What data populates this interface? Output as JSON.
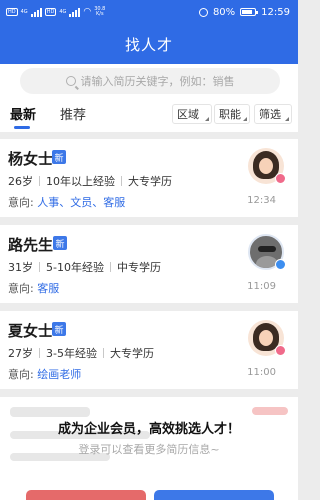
{
  "status_bar": {
    "left_badge_1": "HD",
    "left_badge_2": "HD",
    "network_1": "4G",
    "network_2": "4G",
    "speed_value": "30.8",
    "speed_unit": "K/s",
    "battery": "80%",
    "time": "12:59"
  },
  "header": {
    "title": "找人才"
  },
  "search": {
    "placeholder": "请输入简历关键字，例如：销售"
  },
  "tabs": [
    {
      "label": "最新",
      "active": true
    },
    {
      "label": "推荐",
      "active": false
    }
  ],
  "filters": [
    {
      "label": "区域"
    },
    {
      "label": "职能"
    },
    {
      "label": "筛选"
    }
  ],
  "candidates": [
    {
      "name": "杨女士",
      "badge": "新",
      "age": "26岁",
      "experience": "10年以上经验",
      "education": "大专学历",
      "intent_label": "意向:",
      "intent_jobs": "人事、文员、客服",
      "time": "12:34",
      "gender": "female",
      "avatar_icon": "female-avatar-icon"
    },
    {
      "name": "路先生",
      "badge": "新",
      "age": "31岁",
      "experience": "5-10年经验",
      "education": "中专学历",
      "intent_label": "意向:",
      "intent_jobs": "客服",
      "time": "11:09",
      "gender": "male",
      "avatar_icon": "male-avatar-icon"
    },
    {
      "name": "夏女士",
      "badge": "新",
      "age": "27岁",
      "experience": "3-5年经验",
      "education": "大专学历",
      "intent_label": "意向:",
      "intent_jobs": "绘画老师",
      "time": "11:00",
      "gender": "female",
      "avatar_icon": "female-avatar-icon"
    }
  ],
  "promo": {
    "title": "成为企业会员，高效挑选人才！",
    "subtitle": "登录可以查看更多简历信息~"
  },
  "colors": {
    "brand_blue": "#2f6be5",
    "new_badge": "#3d78e8",
    "female_badge": "#f06a8a",
    "male_badge": "#3d8ef0",
    "accent_red": "#e56a6a"
  }
}
